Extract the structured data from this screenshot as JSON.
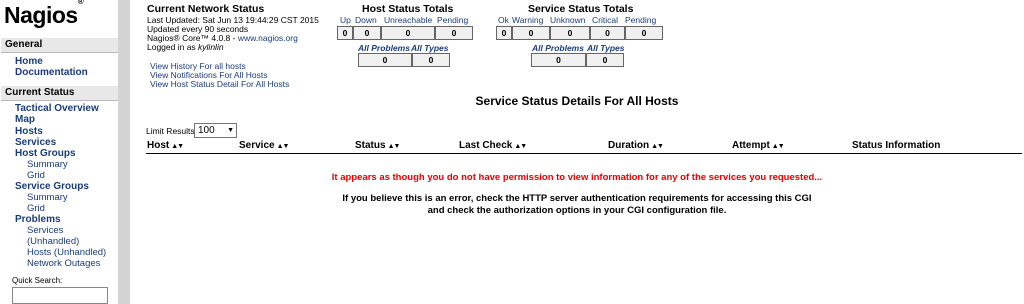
{
  "logo": {
    "text": "Nagios",
    "mark": "®"
  },
  "nav": {
    "general_header": "General",
    "home": "Home",
    "documentation": "Documentation",
    "current_status_header": "Current Status",
    "tactical_overview": "Tactical Overview",
    "map": "Map",
    "hosts": "Hosts",
    "services": "Services",
    "host_groups": "Host Groups",
    "hg_summary": "Summary",
    "hg_grid": "Grid",
    "service_groups": "Service Groups",
    "sg_summary": "Summary",
    "sg_grid": "Grid",
    "problems": "Problems",
    "p_services": "Services",
    "p_unhandled": "(Unhandled)",
    "p_hosts_unhandled": "Hosts (Unhandled)",
    "p_network_outages": "Network Outages",
    "quick_search_label": "Quick Search:",
    "quick_search_value": ""
  },
  "info": {
    "title": "Current Network Status",
    "last_updated": "Last Updated: Sat Jun 13 19:44:29 CST 2015",
    "updated_every": "Updated every 90 seconds",
    "version_prefix": "Nagios® Core™ 4.0.8 - ",
    "version_link": "www.nagios.org",
    "logged_in_prefix": "Logged in as ",
    "user": "kylinlin",
    "link_history": "View History For all hosts",
    "link_notifications": "View Notifications For All Hosts",
    "link_host_status": "View Host Status Detail For All Hosts"
  },
  "host_totals": {
    "title": "Host Status Totals",
    "headers": [
      "Up",
      "Down",
      "Unreachable",
      "Pending"
    ],
    "values": [
      "0",
      "0",
      "0",
      "0"
    ],
    "sub_headers": [
      "All Problems",
      "All Types"
    ],
    "sub_values": [
      "0",
      "0"
    ]
  },
  "service_totals": {
    "title": "Service Status Totals",
    "headers": [
      "Ok",
      "Warning",
      "Unknown",
      "Critical",
      "Pending"
    ],
    "values": [
      "0",
      "0",
      "0",
      "0",
      "0"
    ],
    "sub_headers": [
      "All Problems",
      "All Types"
    ],
    "sub_values": [
      "0",
      "0"
    ]
  },
  "page_title": "Service Status Details For All Hosts",
  "limit": {
    "label": "Limit Results:",
    "value": "100"
  },
  "columns": [
    "Host",
    "Service",
    "Status",
    "Last Check",
    "Duration",
    "Attempt",
    "Status Information"
  ],
  "sort_icon": "▲▼",
  "error": {
    "line1": "It appears as though you do not have permission to view information for any of the services you requested...",
    "line2": "If you believe this is an error, check the HTTP server authentication requirements for accessing this CGI",
    "line3": "and check the authorization options in your CGI configuration file."
  }
}
